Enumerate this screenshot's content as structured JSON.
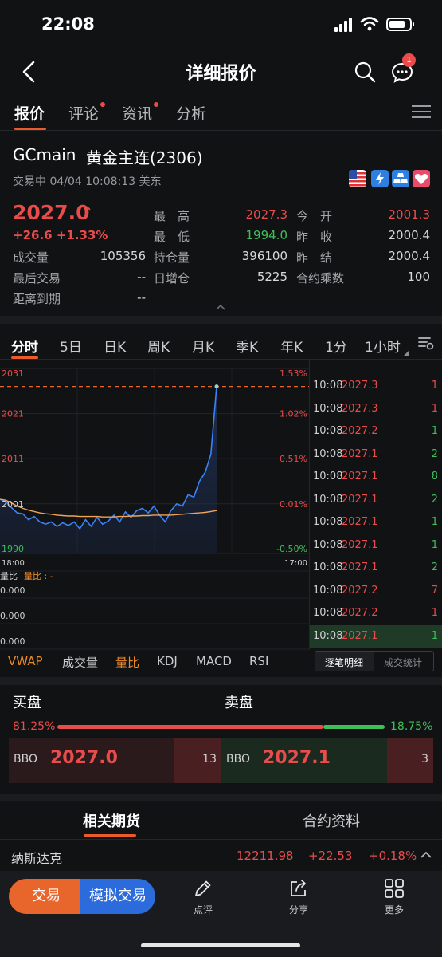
{
  "status_bar": {
    "time": "22:08"
  },
  "header": {
    "title": "详细报价",
    "msg_badge": "1"
  },
  "tabs": [
    {
      "label": "报价",
      "active": true,
      "dot": false
    },
    {
      "label": "评论",
      "active": false,
      "dot": true
    },
    {
      "label": "资讯",
      "active": false,
      "dot": true
    },
    {
      "label": "分析",
      "active": false,
      "dot": false
    }
  ],
  "symbol": {
    "code": "GCmain",
    "name": "黄金主连(2306)",
    "status": "交易中 04/04 10:08:13 美东",
    "price": "2027.0",
    "change": "+26.6",
    "change_pct": "+1.33%"
  },
  "stats": {
    "high_label": "最　高",
    "high": "2027.3",
    "low_label": "最　低",
    "low": "1994.0",
    "open_label": "今　开",
    "open": "2001.3",
    "prev_close_label": "昨　收",
    "prev_close": "2000.4",
    "prev_settle_label": "昨　结",
    "prev_settle": "2000.4",
    "volume_label": "成交量",
    "volume": "105356",
    "open_interest_label": "持仓量",
    "open_interest": "396100",
    "last_trade_label": "最后交易",
    "last_trade": "--",
    "daily_oi_label": "日增仓",
    "daily_oi": "5225",
    "multiplier_label": "合约乘数",
    "multiplier": "100",
    "expiry_label": "距离到期",
    "expiry": "--"
  },
  "chart_tabs": [
    "分时",
    "5日",
    "日K",
    "周K",
    "月K",
    "季K",
    "年K",
    "1分",
    "1小时"
  ],
  "chart_data": {
    "type": "line",
    "title": "",
    "y_left_ticks": [
      "2031",
      "2021",
      "2011",
      "2001",
      "1990"
    ],
    "y_right_ticks": [
      "1.53%",
      "1.02%",
      "0.51%",
      "0.01%",
      "-0.50%"
    ],
    "x_ticks": [
      "18:00",
      "17:00"
    ],
    "ylim": [
      1990,
      2031
    ],
    "last_price": 2027.0,
    "series": [
      {
        "values": [
          2002.0,
          2001.5,
          2000.2,
          1999.0,
          1998.8,
          1997.5,
          1998.2,
          1997.0,
          1996.5,
          1997.0,
          1996.0,
          1996.8,
          1996.2,
          1997.0,
          1995.5,
          1997.5,
          1996.0,
          1998.0,
          1996.5,
          1997.2,
          1998.5,
          1997.0,
          1999.2,
          1998.0,
          1999.5,
          2000.0,
          1999.0,
          2000.5,
          1998.5,
          1997.0,
          1999.5,
          2001.0,
          2000.5,
          2003.0,
          2002.5,
          2006.0,
          2008.0,
          2012.0,
          2027.0
        ]
      },
      {
        "values": [
          2002.0,
          2001.8,
          2001.2,
          2000.5,
          2000.0,
          1999.6,
          1999.3,
          1999.0,
          1998.8,
          1998.7,
          1998.5,
          1998.4,
          1998.3,
          1998.3,
          1998.2,
          1998.2,
          1998.2,
          1998.2,
          1998.1,
          1998.1,
          1998.1,
          1998.2,
          1998.2,
          1998.3,
          1998.3,
          1998.4,
          1998.4,
          1998.5,
          1998.5,
          1998.5,
          1998.5,
          1998.6,
          1998.7,
          1998.8,
          1998.9,
          1999.0,
          1999.1,
          1999.3,
          1999.5
        ]
      }
    ]
  },
  "volume_panel": {
    "label": "量比",
    "legend": "量比 : -",
    "ticks": [
      "0.000",
      "0.000",
      "0.000"
    ]
  },
  "indicator_tabs": [
    "VWAP",
    "成交量",
    "量比",
    "KDJ",
    "MACD",
    "RSI"
  ],
  "ticker": {
    "rows": [
      {
        "time": "10:08",
        "price": "2027.3",
        "vol": "1",
        "vol_color": "red"
      },
      {
        "time": "10:08",
        "price": "2027.3",
        "vol": "1",
        "vol_color": "red"
      },
      {
        "time": "10:08",
        "price": "2027.2",
        "vol": "1",
        "vol_color": "green"
      },
      {
        "time": "10:08",
        "price": "2027.1",
        "vol": "2",
        "vol_color": "green"
      },
      {
        "time": "10:08",
        "price": "2027.1",
        "vol": "8",
        "vol_color": "green"
      },
      {
        "time": "10:08",
        "price": "2027.1",
        "vol": "2",
        "vol_color": "green"
      },
      {
        "time": "10:08",
        "price": "2027.1",
        "vol": "1",
        "vol_color": "green"
      },
      {
        "time": "10:08",
        "price": "2027.1",
        "vol": "1",
        "vol_color": "green"
      },
      {
        "time": "10:08",
        "price": "2027.1",
        "vol": "2",
        "vol_color": "green"
      },
      {
        "time": "10:08",
        "price": "2027.2",
        "vol": "7",
        "vol_color": "red"
      },
      {
        "time": "10:08",
        "price": "2027.2",
        "vol": "1",
        "vol_color": "red"
      },
      {
        "time": "10:08",
        "price": "2027.1",
        "vol": "1",
        "vol_color": "green"
      }
    ],
    "tab_detail": "逐笔明细",
    "tab_stats": "成交统计"
  },
  "order_book": {
    "buy_label": "买盘",
    "sell_label": "卖盘",
    "buy_pct": "81.25%",
    "sell_pct": "18.75%",
    "buy_fraction": 0.8125,
    "bid_tag": "BBO",
    "bid_price": "2027.0",
    "bid_qty": "13",
    "ask_tag": "BBO",
    "ask_price": "2027.1",
    "ask_qty": "3"
  },
  "bottom_tabs": {
    "related": "相关期货",
    "contract": "合约资料"
  },
  "related": {
    "name": "纳斯达克",
    "price": "12211.98",
    "change": "+22.53",
    "change_pct": "+0.18%"
  },
  "nav": {
    "trade": "交易",
    "sim_trade": "模拟交易",
    "comment": "点评",
    "share": "分享",
    "more": "更多"
  },
  "colors": {
    "up": "#ea4b4b",
    "down": "#3fbf5a",
    "accent": "#ea5a2a",
    "blue": "#2c6bdc"
  }
}
